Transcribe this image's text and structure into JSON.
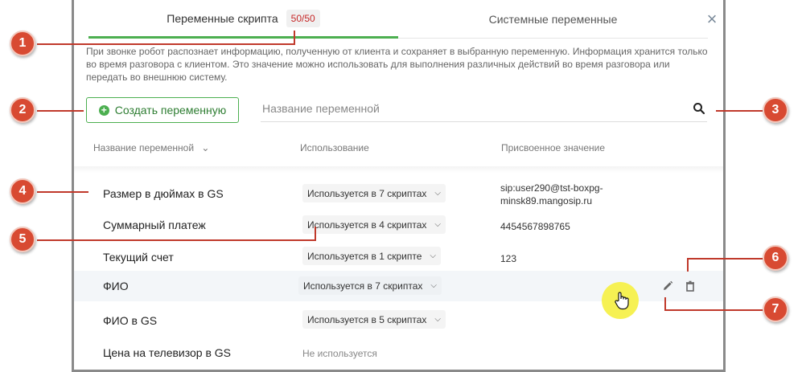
{
  "tabs": {
    "script_vars": "Переменные скрипта",
    "count_badge": "50/50",
    "system_vars": "Системные переменные"
  },
  "info_text": "При звонке робот распознает информацию, полученную от клиента и сохраняет в выбранную переменную. Информация хранится только во время разговора с клиентом. Это значение можно использовать для выполнения различных действий во время разговора или передать во внешнюю систему.",
  "create_button": "Создать переменную",
  "search": {
    "placeholder": "Название переменной"
  },
  "columns": {
    "name": "Название переменной",
    "usage": "Использование",
    "value": "Присвоенное значение"
  },
  "rows": [
    {
      "name": "Размер в дюймах в GS",
      "usage": "Используется в 7 скриптах",
      "value_line1": "sip:user290@tst-boxpg-",
      "value_line2": "minsk89.mangosip.ru"
    },
    {
      "name": "Суммарный платеж",
      "usage": "Используется в 4 скриптах",
      "value_line1": "4454567898765",
      "value_line2": ""
    },
    {
      "name": "Текущий счет",
      "usage": "Используется в 1 скрипте",
      "value_line1": "123",
      "value_line2": ""
    },
    {
      "name": "ФИО",
      "usage": "Используется в 7 скриптах",
      "value_line1": "",
      "value_line2": ""
    },
    {
      "name": "ФИО в GS",
      "usage": "Используется в 5 скриптах",
      "value_line1": "",
      "value_line2": ""
    },
    {
      "name": "Цена на телевизор в GS",
      "usage": "Не используется",
      "value_line1": "",
      "value_line2": ""
    }
  ],
  "callouts": [
    "1",
    "2",
    "3",
    "4",
    "5",
    "6",
    "7"
  ],
  "colors": {
    "accent_green": "#4caf50",
    "badge_red": "#c62828",
    "callout_red": "#d84a32",
    "cursor_highlight": "#f5f04a"
  },
  "icons": [
    "close-icon",
    "plus-circle-icon",
    "search-icon",
    "chevron-down-icon",
    "pencil-icon",
    "trash-icon",
    "hand-cursor-icon"
  ]
}
